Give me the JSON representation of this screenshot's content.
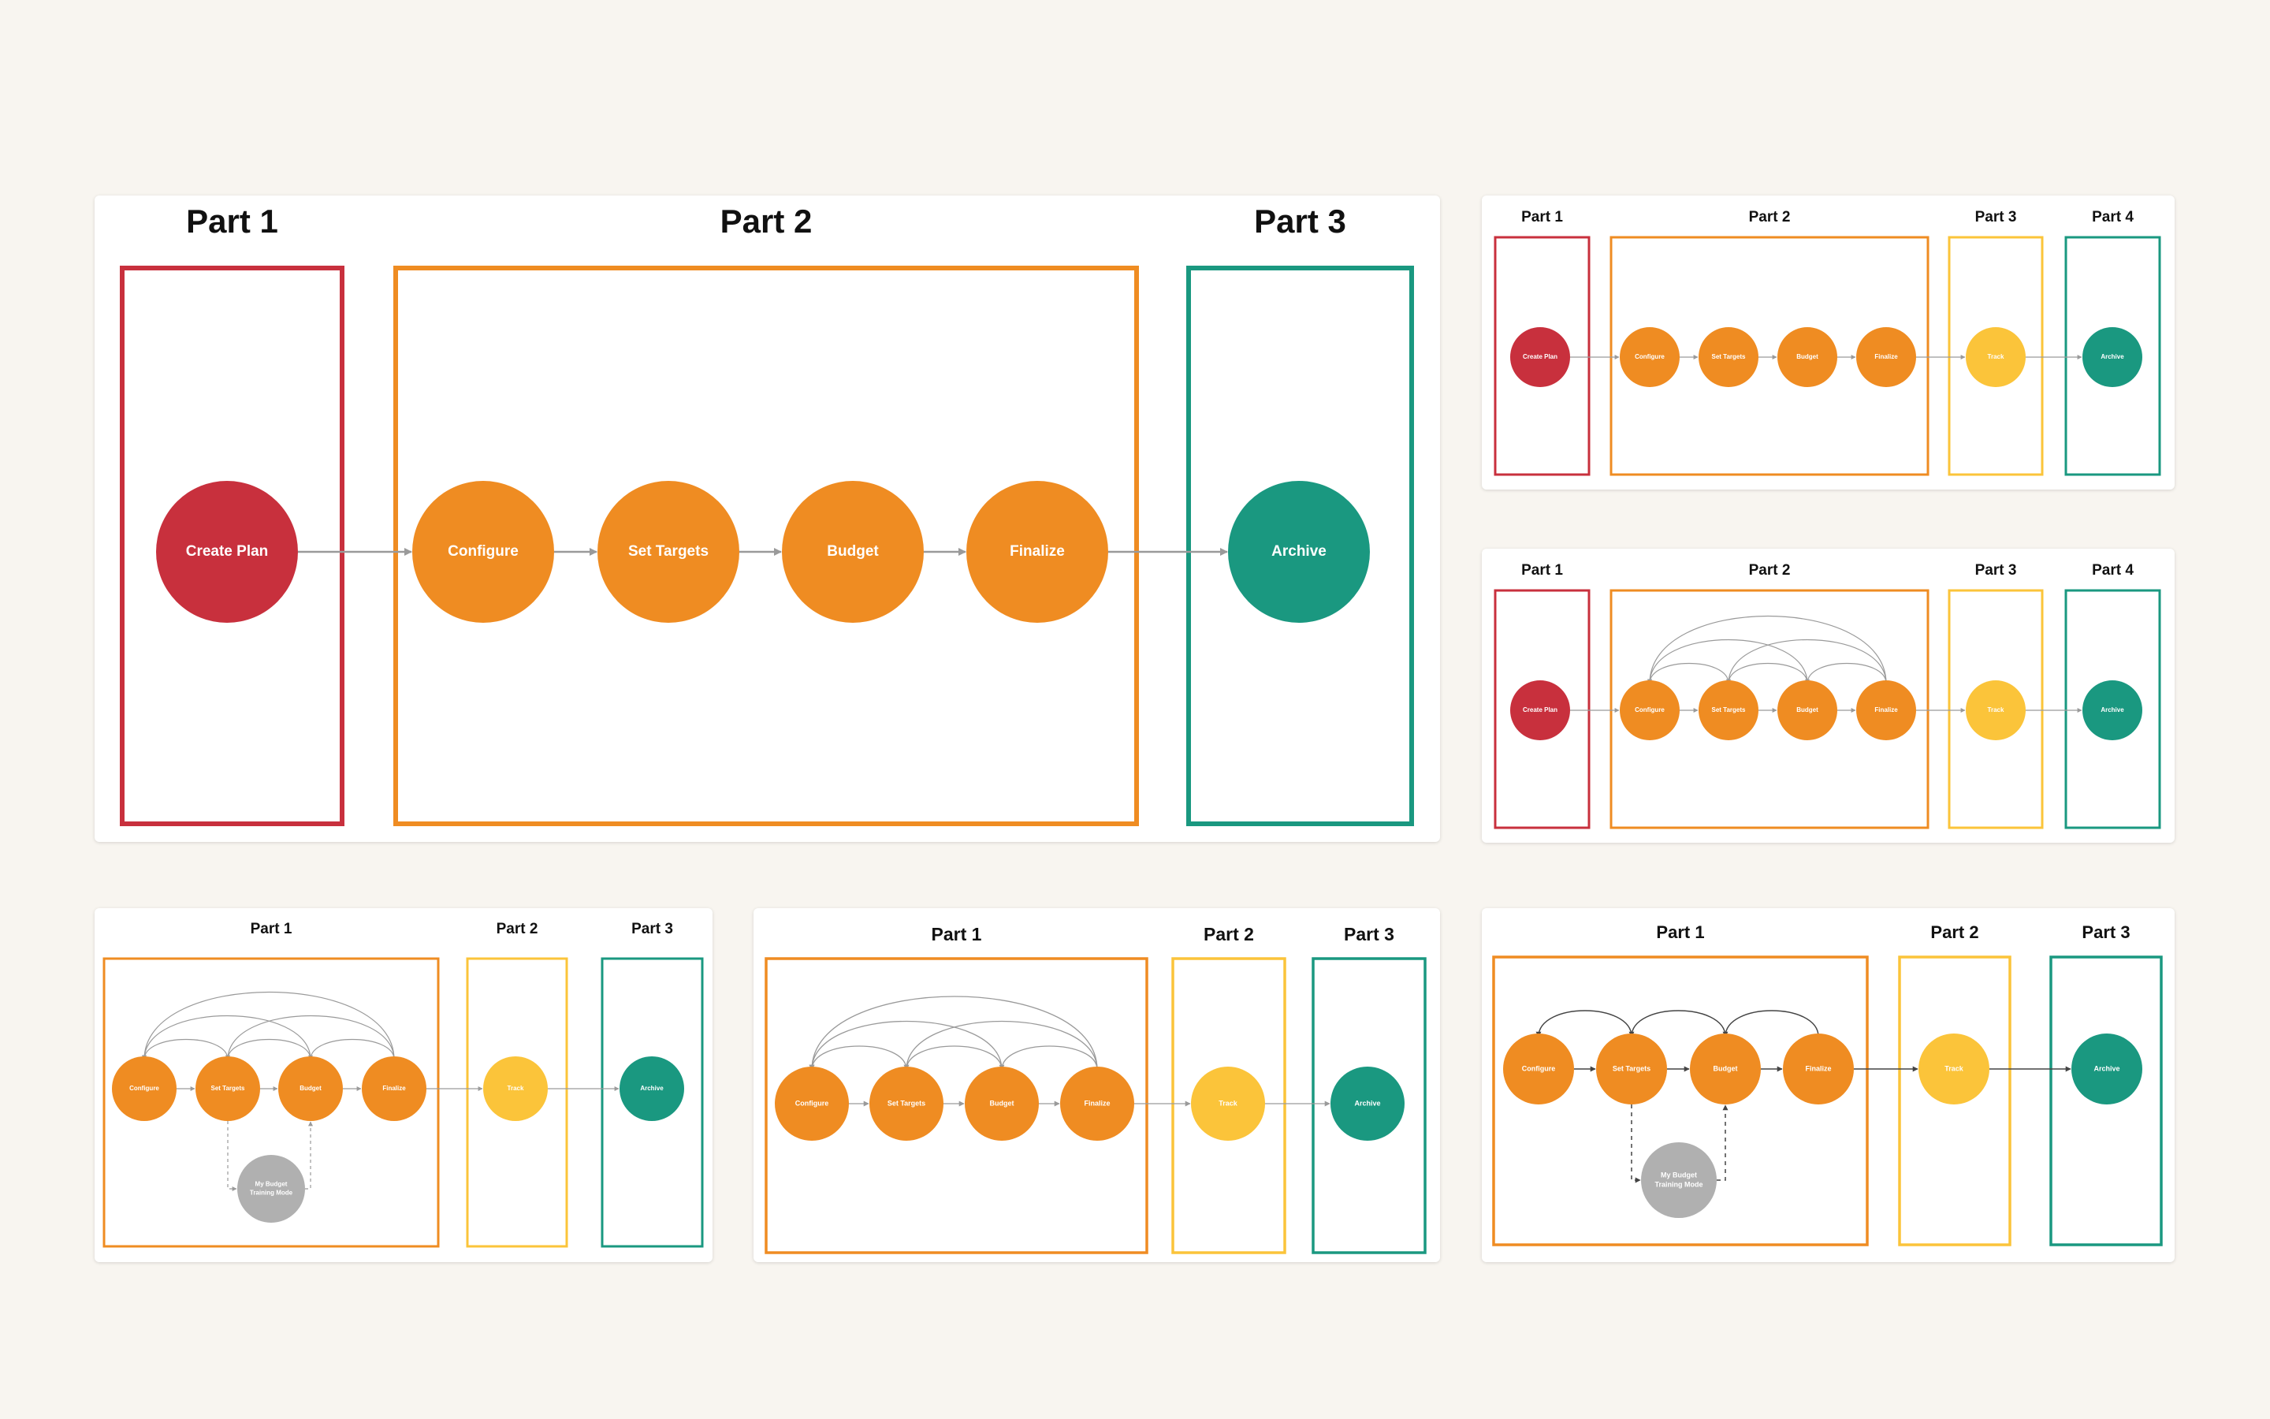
{
  "colors": {
    "red": "#c8303d",
    "orange": "#ef8c22",
    "yellow": "#fbc43a",
    "teal": "#1a9880",
    "gray": "#b0b0b0",
    "connector": "#9a9a9a",
    "connector_dark": "#444444",
    "background": "#f8f5f0"
  },
  "diagrams": [
    {
      "parts": [
        {
          "label": "Part 1",
          "color": "red"
        },
        {
          "label": "Part 2",
          "color": "orange"
        },
        {
          "label": "Part 3",
          "color": "teal"
        }
      ],
      "nodes": [
        {
          "label": "Create Plan",
          "color": "red"
        },
        {
          "label": "Configure",
          "color": "orange"
        },
        {
          "label": "Set Targets",
          "color": "orange"
        },
        {
          "label": "Budget",
          "color": "orange"
        },
        {
          "label": "Finalize",
          "color": "orange"
        },
        {
          "label": "Archive",
          "color": "teal"
        }
      ],
      "flow": [
        "Create Plan",
        "Configure",
        "Set Targets",
        "Budget",
        "Finalize",
        "Archive"
      ],
      "loops": [],
      "side_node": null
    },
    {
      "parts": [
        {
          "label": "Part 1",
          "color": "red"
        },
        {
          "label": "Part 2",
          "color": "orange"
        },
        {
          "label": "Part 3",
          "color": "yellow"
        },
        {
          "label": "Part 4",
          "color": "teal"
        }
      ],
      "nodes": [
        {
          "label": "Create Plan",
          "color": "red"
        },
        {
          "label": "Configure",
          "color": "orange"
        },
        {
          "label": "Set Targets",
          "color": "orange"
        },
        {
          "label": "Budget",
          "color": "orange"
        },
        {
          "label": "Finalize",
          "color": "orange"
        },
        {
          "label": "Track",
          "color": "yellow"
        },
        {
          "label": "Archive",
          "color": "teal"
        }
      ],
      "flow": [
        "Create Plan",
        "Configure",
        "Set Targets",
        "Budget",
        "Finalize",
        "Track",
        "Archive"
      ],
      "loops": [],
      "side_node": null
    },
    {
      "parts": [
        {
          "label": "Part 1",
          "color": "red"
        },
        {
          "label": "Part 2",
          "color": "orange"
        },
        {
          "label": "Part 3",
          "color": "yellow"
        },
        {
          "label": "Part 4",
          "color": "teal"
        }
      ],
      "nodes": [
        {
          "label": "Create Plan",
          "color": "red"
        },
        {
          "label": "Configure",
          "color": "orange"
        },
        {
          "label": "Set Targets",
          "color": "orange"
        },
        {
          "label": "Budget",
          "color": "orange"
        },
        {
          "label": "Finalize",
          "color": "orange"
        },
        {
          "label": "Track",
          "color": "yellow"
        },
        {
          "label": "Archive",
          "color": "teal"
        }
      ],
      "flow": [
        "Create Plan",
        "Configure",
        "Set Targets",
        "Budget",
        "Finalize",
        "Track",
        "Archive"
      ],
      "loops": [
        [
          "Set Targets",
          "Configure"
        ],
        [
          "Budget",
          "Set Targets"
        ],
        [
          "Finalize",
          "Budget"
        ],
        [
          "Budget",
          "Configure"
        ],
        [
          "Finalize",
          "Set Targets"
        ],
        [
          "Finalize",
          "Configure"
        ]
      ],
      "side_node": null
    },
    {
      "parts": [
        {
          "label": "Part 1",
          "color": "orange"
        },
        {
          "label": "Part 2",
          "color": "yellow"
        },
        {
          "label": "Part 3",
          "color": "teal"
        }
      ],
      "nodes": [
        {
          "label": "Configure",
          "color": "orange"
        },
        {
          "label": "Set Targets",
          "color": "orange"
        },
        {
          "label": "Budget",
          "color": "orange"
        },
        {
          "label": "Finalize",
          "color": "orange"
        },
        {
          "label": "Track",
          "color": "yellow"
        },
        {
          "label": "Archive",
          "color": "teal"
        }
      ],
      "flow": [
        "Configure",
        "Set Targets",
        "Budget",
        "Finalize",
        "Track",
        "Archive"
      ],
      "loops": [
        [
          "Set Targets",
          "Configure"
        ],
        [
          "Budget",
          "Set Targets"
        ],
        [
          "Finalize",
          "Budget"
        ],
        [
          "Budget",
          "Configure"
        ],
        [
          "Finalize",
          "Set Targets"
        ],
        [
          "Finalize",
          "Configure"
        ]
      ],
      "side_node": {
        "lines": [
          "My Budget",
          "Training Mode"
        ],
        "color": "gray",
        "from": "Set Targets",
        "to": "Budget"
      }
    },
    {
      "parts": [
        {
          "label": "Part 1",
          "color": "orange"
        },
        {
          "label": "Part 2",
          "color": "yellow"
        },
        {
          "label": "Part 3",
          "color": "teal"
        }
      ],
      "nodes": [
        {
          "label": "Configure",
          "color": "orange"
        },
        {
          "label": "Set Targets",
          "color": "orange"
        },
        {
          "label": "Budget",
          "color": "orange"
        },
        {
          "label": "Finalize",
          "color": "orange"
        },
        {
          "label": "Track",
          "color": "yellow"
        },
        {
          "label": "Archive",
          "color": "teal"
        }
      ],
      "flow": [
        "Configure",
        "Set Targets",
        "Budget",
        "Finalize",
        "Track",
        "Archive"
      ],
      "loops": [
        [
          "Set Targets",
          "Configure"
        ],
        [
          "Budget",
          "Set Targets"
        ],
        [
          "Finalize",
          "Budget"
        ],
        [
          "Budget",
          "Configure"
        ],
        [
          "Finalize",
          "Set Targets"
        ],
        [
          "Finalize",
          "Configure"
        ]
      ],
      "side_node": null
    },
    {
      "parts": [
        {
          "label": "Part 1",
          "color": "orange"
        },
        {
          "label": "Part 2",
          "color": "yellow"
        },
        {
          "label": "Part 3",
          "color": "teal"
        }
      ],
      "nodes": [
        {
          "label": "Configure",
          "color": "orange"
        },
        {
          "label": "Set Targets",
          "color": "orange"
        },
        {
          "label": "Budget",
          "color": "orange"
        },
        {
          "label": "Finalize",
          "color": "orange"
        },
        {
          "label": "Track",
          "color": "yellow"
        },
        {
          "label": "Archive",
          "color": "teal"
        }
      ],
      "flow": [
        "Configure",
        "Set Targets",
        "Budget",
        "Finalize",
        "Track",
        "Archive"
      ],
      "loops": [
        [
          "Set Targets",
          "Configure"
        ],
        [
          "Budget",
          "Set Targets"
        ],
        [
          "Finalize",
          "Budget"
        ]
      ],
      "side_node": {
        "lines": [
          "My Budget",
          "Training Mode"
        ],
        "color": "gray",
        "from": "Set Targets",
        "to": "Budget"
      }
    }
  ]
}
